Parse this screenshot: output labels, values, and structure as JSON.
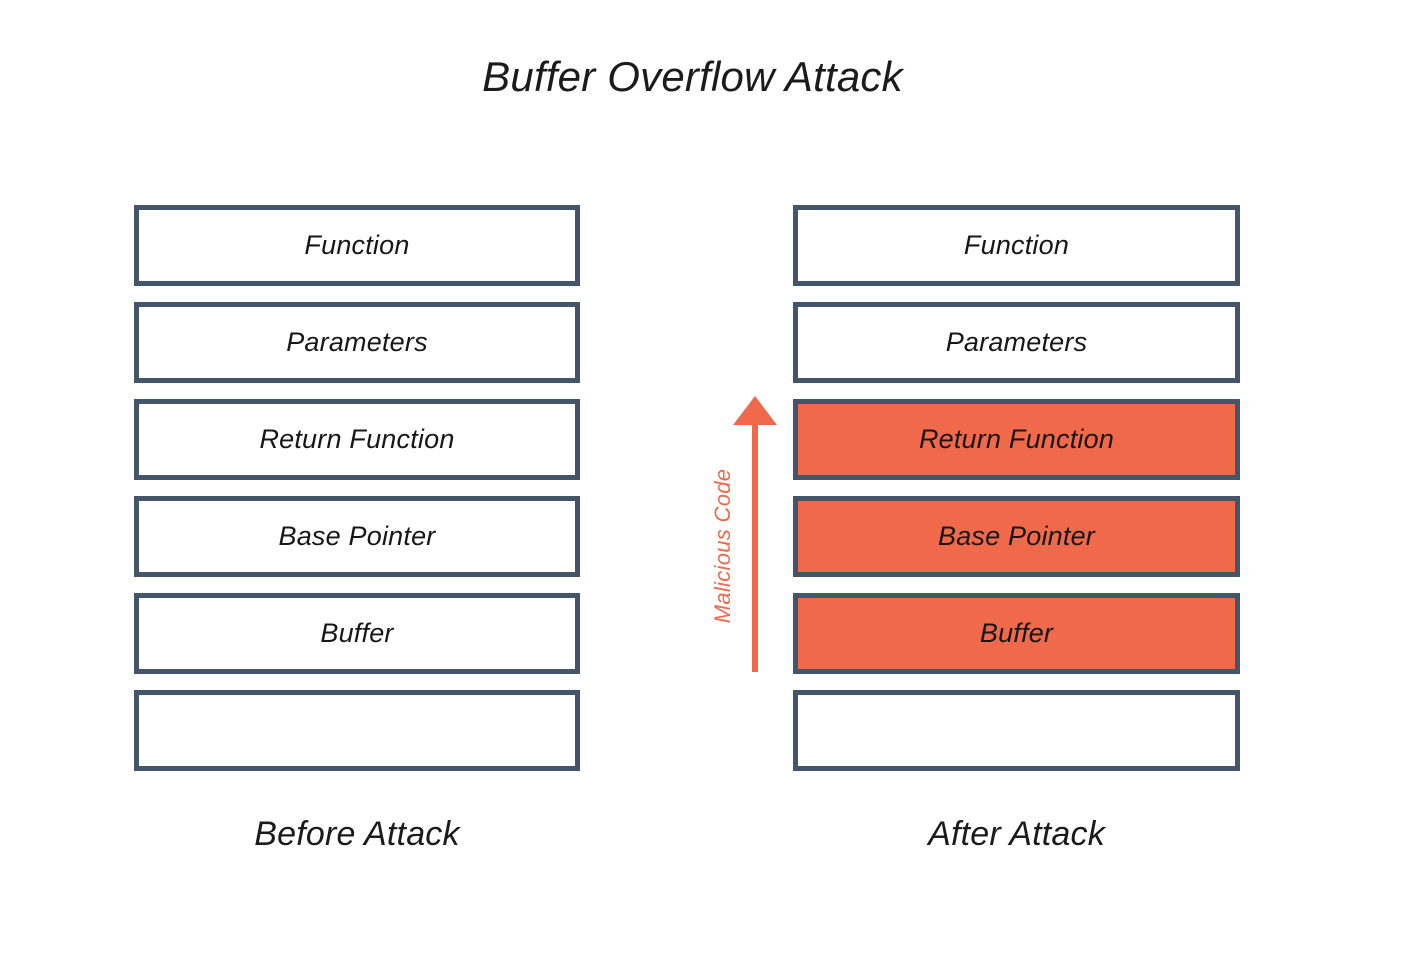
{
  "title": "Buffer Overflow Attack",
  "colors": {
    "background": "#ffffff",
    "frame_border": "#445469",
    "frame_fill_normal": "#ffffff",
    "frame_fill_overflow": "#F0694A",
    "accent_orange": "#F0694A",
    "text": "#1b1b1b"
  },
  "columns": {
    "before": {
      "caption": "Before Attack",
      "frames": [
        {
          "label": "Function",
          "overflowed": false
        },
        {
          "label": "Parameters",
          "overflowed": false
        },
        {
          "label": "Return Function",
          "overflowed": false
        },
        {
          "label": "Base Pointer",
          "overflowed": false
        },
        {
          "label": "Buffer",
          "overflowed": false
        },
        {
          "label": "",
          "overflowed": false
        }
      ]
    },
    "after": {
      "caption": "After Attack",
      "frames": [
        {
          "label": "Function",
          "overflowed": false
        },
        {
          "label": "Parameters",
          "overflowed": false
        },
        {
          "label": "Return Function",
          "overflowed": true
        },
        {
          "label": "Base Pointer",
          "overflowed": true
        },
        {
          "label": "Buffer",
          "overflowed": true
        },
        {
          "label": "",
          "overflowed": false
        }
      ]
    }
  },
  "annotation": {
    "label": "Malicious Code",
    "direction": "upward",
    "icon": "up-arrow-icon",
    "color": "#F0694A"
  }
}
